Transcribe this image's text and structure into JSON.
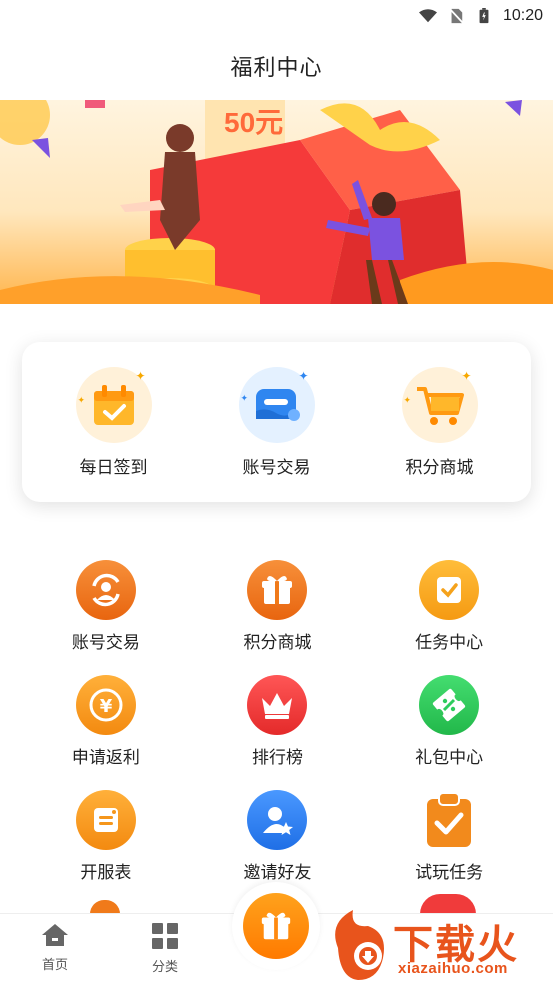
{
  "status_bar": {
    "time": "10:20"
  },
  "header": {
    "title": "福利中心"
  },
  "banner": {
    "badge_text": "50元"
  },
  "featured": [
    {
      "label": "每日签到",
      "icon": "calendar-check-icon",
      "bg": "#fff1d9"
    },
    {
      "label": "账号交易",
      "icon": "account-trade-icon",
      "bg": "#e4f1ff"
    },
    {
      "label": "积分商城",
      "icon": "cart-icon",
      "bg": "#fff1d9"
    }
  ],
  "grid": [
    {
      "label": "账号交易",
      "icon": "account-swap-icon",
      "color": "#f07a1a"
    },
    {
      "label": "积分商城",
      "icon": "gift-icon",
      "color": "#f07a1a"
    },
    {
      "label": "任务中心",
      "icon": "task-check-icon",
      "color": "#f5a21b"
    },
    {
      "label": "申请返利",
      "icon": "yuan-coin-icon",
      "color": "#f5961b"
    },
    {
      "label": "排行榜",
      "icon": "crown-icon",
      "color": "#f03b3b"
    },
    {
      "label": "礼包中心",
      "icon": "ticket-icon",
      "color": "#2ecc5d"
    },
    {
      "label": "开服表",
      "icon": "note-icon",
      "color": "#f5961b"
    },
    {
      "label": "邀请好友",
      "icon": "invite-user-icon",
      "color": "#2f7ff0"
    },
    {
      "label": "试玩任务",
      "icon": "clipboard-check-icon",
      "color": "#f07a1a"
    }
  ],
  "bottom_nav": [
    {
      "label": "首页",
      "icon": "home-icon"
    },
    {
      "label": "分类",
      "icon": "category-grid-icon"
    }
  ],
  "watermark": {
    "text_cn": "下载火",
    "text_en": "xiazaihuo.com"
  }
}
